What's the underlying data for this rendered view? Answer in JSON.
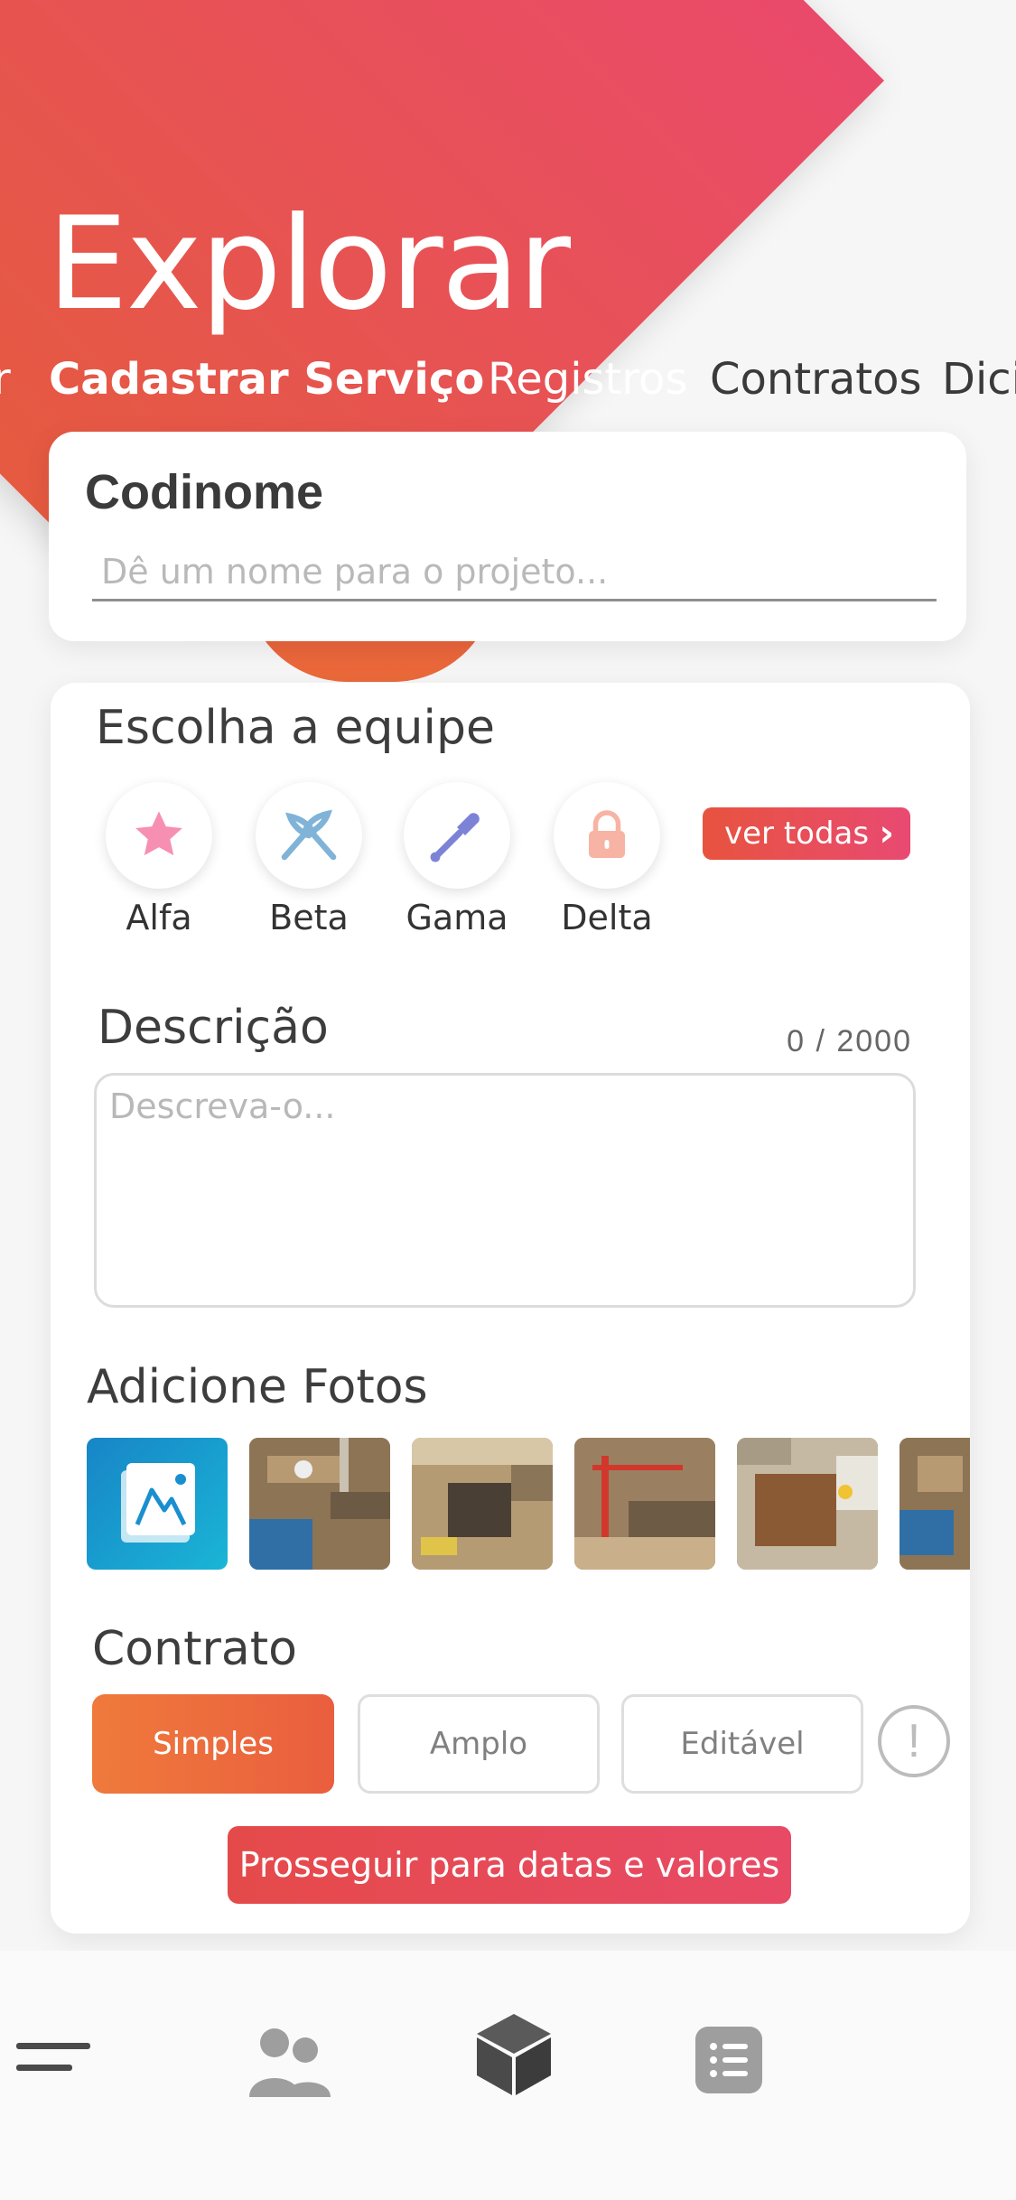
{
  "header": {
    "title": "Explorar",
    "tabs": [
      "r",
      "Cadastrar Serviço",
      "Registros",
      "Contratos",
      "Dici"
    ],
    "active_tab": "Cadastrar Serviço"
  },
  "project": {
    "label": "Codinome",
    "placeholder": "Dê um nome para o projeto..."
  },
  "team": {
    "label": "Escolha a equipe",
    "options": [
      {
        "name": "Alfa",
        "icon": "star-icon",
        "color": "#f78fb3"
      },
      {
        "name": "Beta",
        "icon": "pliers-icon",
        "color": "#7fb3d8"
      },
      {
        "name": "Gama",
        "icon": "shovel-icon",
        "color": "#7c83d6"
      },
      {
        "name": "Delta",
        "icon": "lock-icon",
        "color": "#f7b3a3"
      }
    ],
    "see_all": "ver todas"
  },
  "description": {
    "label": "Descrição",
    "counter": "0 / 2000",
    "placeholder": "Descreva-o..."
  },
  "photos": {
    "label": "Adicione Fotos",
    "add_icon": "add-photo-icon",
    "count": 5
  },
  "contract": {
    "label": "Contrato",
    "options": [
      "Simples",
      "Amplo",
      "Editável"
    ],
    "selected": "Simples",
    "info_icon": "info-icon"
  },
  "proceed_label": "Prosseguir para datas e valores",
  "nav": [
    "menu-icon",
    "people-icon",
    "cube-icon",
    "list-icon"
  ],
  "colors": {
    "accent": "#e84a5f",
    "orange": "#ef7a3c",
    "active_nav": "#4a4a4a",
    "inactive_nav": "#9e9e9e"
  }
}
